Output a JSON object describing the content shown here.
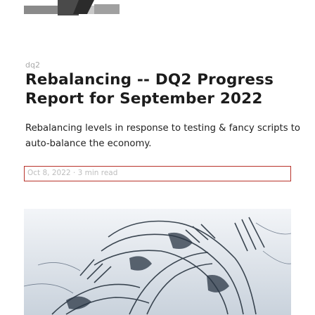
{
  "post": {
    "tag": "dq2",
    "title": "Rebalancing -- DQ2 Progress Report for September 2022",
    "description": "Rebalancing levels in response to testing & fancy scripts to auto-balance the economy.",
    "meta": "Oct 8, 2022 · 3 min read"
  }
}
